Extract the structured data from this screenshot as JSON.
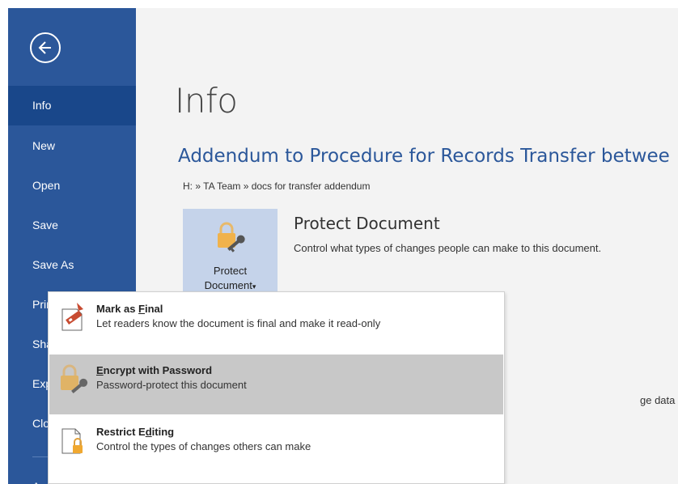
{
  "colors": {
    "sidebar_bg": "#2b579a",
    "sidebar_active": "#19478a",
    "accent_title": "#2b579a",
    "content_bg": "#f3f3f3",
    "menu_hover": "#c8c8c8"
  },
  "sidebar": {
    "back_icon": "back-arrow-icon",
    "items": [
      {
        "label": "Info",
        "active": true
      },
      {
        "label": "New"
      },
      {
        "label": "Open"
      },
      {
        "label": "Save"
      },
      {
        "label": "Save As"
      },
      {
        "label": "Print"
      },
      {
        "label": "Share"
      },
      {
        "label": "Export"
      },
      {
        "label": "Close"
      },
      {
        "label": "Account"
      }
    ]
  },
  "main": {
    "title": "Info",
    "document_title": "Addendum to Procedure for Records Transfer betwee",
    "breadcrumb": "H: » TA Team » docs for transfer addendum",
    "protect": {
      "button_line1": "Protect",
      "button_line2": "Document",
      "button_dropdown_glyph": "▾",
      "icon": "lock-key-icon",
      "heading": "Protect Document",
      "description": "Control what types of changes people can make to this document."
    },
    "background_fragment": "ge data"
  },
  "protect_menu": {
    "items": [
      {
        "title_before": "Mark as ",
        "title_key": "F",
        "title_after": "inal",
        "description": "Let readers know the document is final and make it read-only",
        "icon": "mark-final-icon"
      },
      {
        "title_before": "",
        "title_key": "E",
        "title_after": "ncrypt with Password",
        "description": "Password-protect this document",
        "icon": "lock-key-icon",
        "highlighted": true
      },
      {
        "title_before": "Restrict E",
        "title_key": "d",
        "title_after": "iting",
        "description": "Control the types of changes others can make",
        "icon": "restrict-editing-icon"
      }
    ]
  }
}
